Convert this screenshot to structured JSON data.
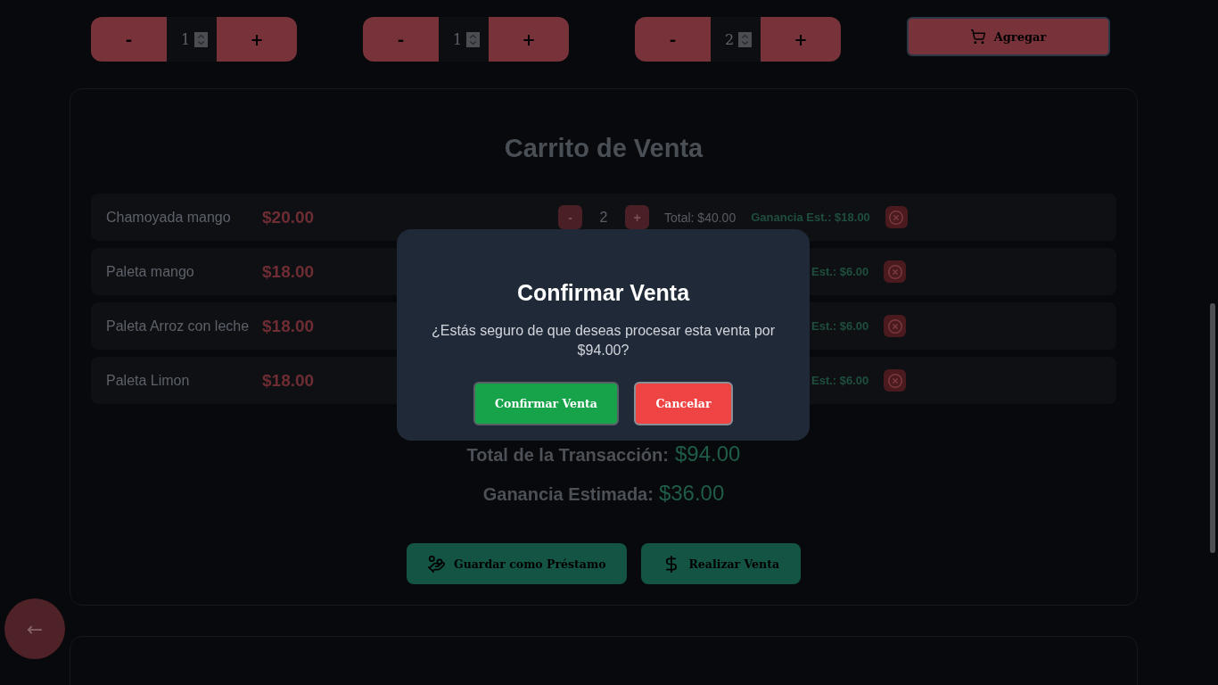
{
  "product_steppers": [
    {
      "minus": "-",
      "quantity": "1",
      "plus": "+"
    },
    {
      "minus": "-",
      "quantity": "1",
      "plus": "+"
    },
    {
      "minus": "-",
      "quantity": "2",
      "plus": "+"
    }
  ],
  "add_button": {
    "label": "Agregar"
  },
  "cart": {
    "title": "Carrito de Venta",
    "items": [
      {
        "name": "Chamoyada mango",
        "price": "$20.00",
        "minus": "-",
        "quantity": "2",
        "plus": "+",
        "total": "Total: $40.00",
        "profit": "Ganancia Est.: $18.00"
      },
      {
        "name": "Paleta mango",
        "price": "$18.00",
        "profit": "Est.: $6.00"
      },
      {
        "name": "Paleta Arroz con leche",
        "price": "$18.00",
        "profit": "Est.: $6.00"
      },
      {
        "name": "Paleta Limon",
        "price": "$18.00",
        "profit": "Est.: $6.00"
      }
    ],
    "transaction_total": {
      "label": "Total de la Transacción:",
      "value": "$94.00"
    },
    "estimated_profit": {
      "label": "Ganancia Estimada:",
      "value": "$36.00"
    },
    "actions": [
      {
        "label": "Guardar como Préstamo",
        "kind": "loan"
      },
      {
        "label": "Realizar Venta",
        "kind": "sale"
      }
    ]
  },
  "back_button": {
    "label": "←"
  },
  "confirm_dialog": {
    "title": "Confirmar Venta",
    "message": "¿Estás seguro de que deseas procesar esta venta por $94.00?",
    "buttons": [
      {
        "label": "Confirmar Venta",
        "kind": "confirm"
      },
      {
        "label": "Cancelar",
        "kind": "cancel"
      }
    ]
  }
}
